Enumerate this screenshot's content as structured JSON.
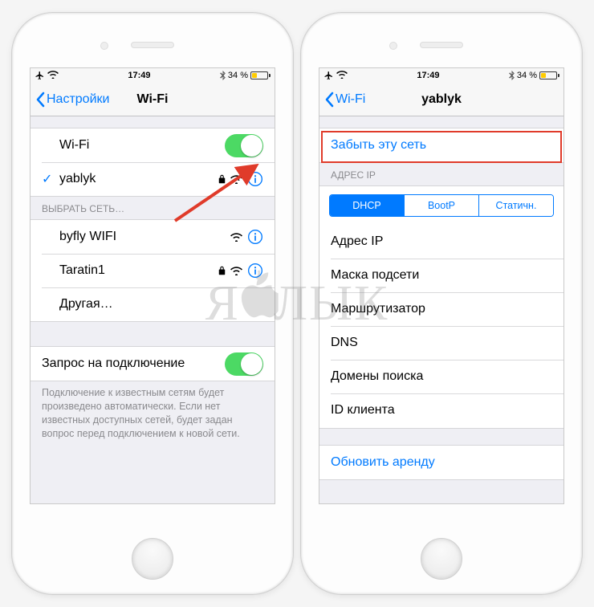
{
  "statusbar": {
    "time": "17:49",
    "battery_percent": "34 %",
    "battery_fill_pct": 34
  },
  "left_phone": {
    "nav": {
      "back_label": "Настройки",
      "title": "Wi-Fi"
    },
    "wifi_toggle_label": "Wi-Fi",
    "connected_network": "yablyk",
    "choose_network_header": "Выбрать сеть…",
    "networks": [
      {
        "name": "byfly WIFI",
        "locked": false
      },
      {
        "name": "Taratin1",
        "locked": true
      }
    ],
    "other_label": "Другая…",
    "ask_to_join_label": "Запрос на подключение",
    "ask_to_join_footer": "Подключение к известным сетям будет произведено автоматически. Если нет известных доступных сетей, будет задан вопрос перед подключением к новой сети."
  },
  "right_phone": {
    "nav": {
      "back_label": "Wi-Fi",
      "title": "yablyk"
    },
    "forget_label": "Забыть эту сеть",
    "ip_header": "Адрес IP",
    "segments": {
      "dhcp": "DHCP",
      "bootp": "BootP",
      "static": "Статичн."
    },
    "rows": {
      "ip": "Адрес IP",
      "mask": "Маска подсети",
      "router": "Маршрутизатор",
      "dns": "DNS",
      "search": "Домены поиска",
      "client_id": "ID клиента"
    },
    "renew_lease": "Обновить аренду"
  },
  "watermark_text": "Я  ЛЫК"
}
